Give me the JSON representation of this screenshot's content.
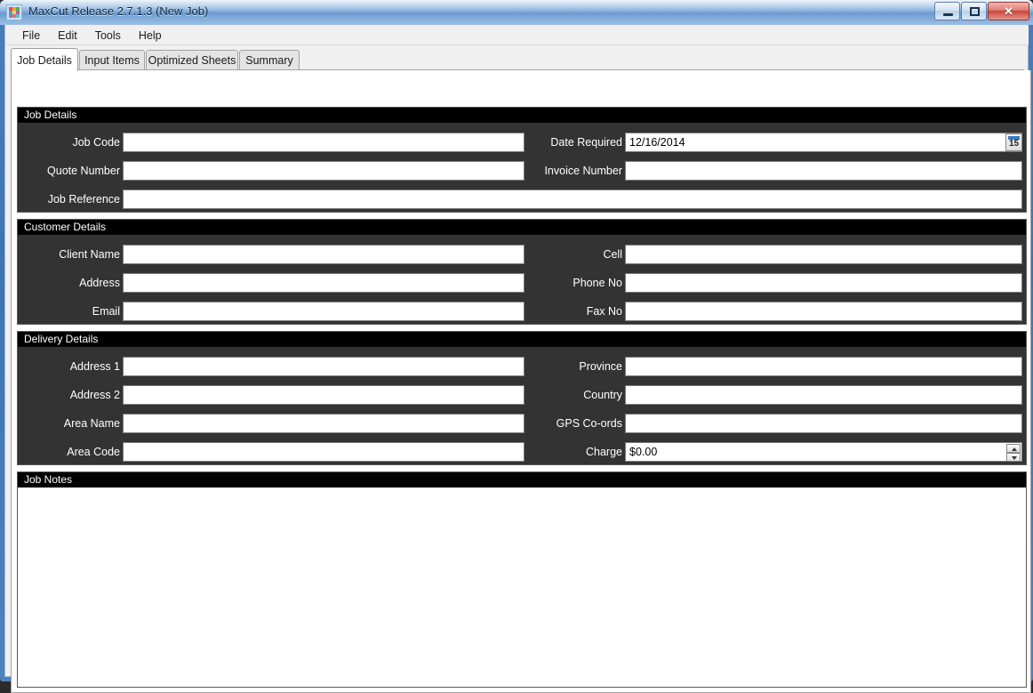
{
  "window": {
    "title": "MaxCut Release 2.7.1.3 (New Job)",
    "app_icon": "maxcut-tiles-icon",
    "buttons": {
      "minimize": "minimize",
      "maximize": "maximize",
      "close": "✕"
    }
  },
  "menubar": {
    "items": [
      "File",
      "Edit",
      "Tools",
      "Help"
    ]
  },
  "tabs": [
    {
      "label": "Job Details",
      "active": true
    },
    {
      "label": "Input Items",
      "active": false
    },
    {
      "label": "Optimized Sheets",
      "active": false
    },
    {
      "label": "Summary",
      "active": false
    }
  ],
  "groups": {
    "job_details": {
      "title": "Job Details",
      "left_fields": [
        {
          "label": "Job Code",
          "value": ""
        },
        {
          "label": "Quote Number",
          "value": ""
        },
        {
          "label": "Job Reference",
          "value": ""
        }
      ],
      "right_fields": [
        {
          "label": "Date Required",
          "value": "12/16/2014",
          "control": "datepicker",
          "icon": "calendar-icon",
          "icon_day": "15"
        },
        {
          "label": "Invoice Number",
          "value": ""
        }
      ]
    },
    "customer_details": {
      "title": "Customer Details",
      "left_fields": [
        {
          "label": "Client Name",
          "value": ""
        },
        {
          "label": "Address",
          "value": ""
        },
        {
          "label": "Email",
          "value": ""
        }
      ],
      "right_fields": [
        {
          "label": "Cell",
          "value": ""
        },
        {
          "label": "Phone No",
          "value": ""
        },
        {
          "label": "Fax No",
          "value": ""
        }
      ]
    },
    "delivery_details": {
      "title": "Delivery Details",
      "left_fields": [
        {
          "label": "Address 1",
          "value": ""
        },
        {
          "label": "Address 2",
          "value": ""
        },
        {
          "label": "Area Name",
          "value": ""
        },
        {
          "label": "Area Code",
          "value": ""
        }
      ],
      "right_fields": [
        {
          "label": "Province",
          "value": ""
        },
        {
          "label": "Country",
          "value": ""
        },
        {
          "label": "GPS Co-ords",
          "value": ""
        },
        {
          "label": "Charge",
          "value": "$0.00",
          "control": "spinner"
        }
      ]
    },
    "job_notes": {
      "title": "Job Notes",
      "value": ""
    }
  },
  "colors": {
    "panel_bg": "#333333",
    "group_header_bg": "#000000",
    "group_header_text": "#ffffff",
    "input_bg": "#ffffff",
    "page_bg": "#ffffff",
    "title_accent": "#4a7ebb",
    "close_button": "#c9453c"
  }
}
